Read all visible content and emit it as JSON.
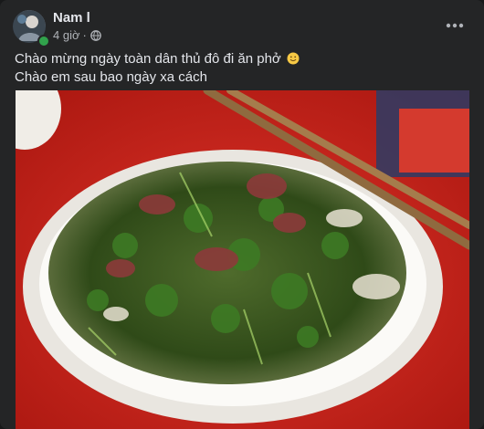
{
  "post": {
    "author_name": "Nam l",
    "time": "4 giờ",
    "separator": "·",
    "audience_icon": "globe-icon",
    "more_icon": "more-options-icon",
    "text_lines": [
      "Chào mừng ngày toàn dân thủ đô đi ăn phở",
      "Chào em sau bao ngày xa cách"
    ],
    "emoji": "slightly-smiling-face-emoji",
    "photo_subject": "bowl-of-pho-photo"
  },
  "colors": {
    "background": "#242526",
    "text_primary": "#e4e6eb",
    "text_secondary": "#b0b3b8",
    "online": "#31a24c",
    "table_red": "#d52a1f"
  }
}
